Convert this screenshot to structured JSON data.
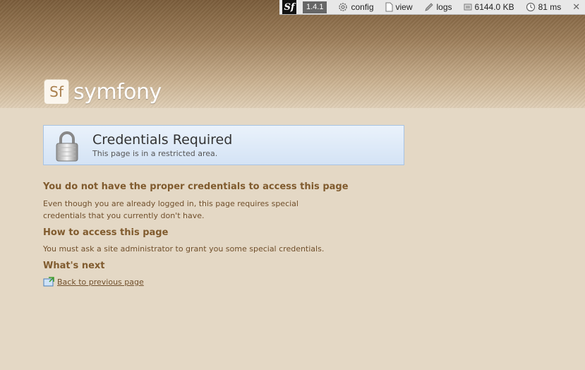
{
  "toolbar": {
    "logo": "Sf",
    "version": "1.4.1",
    "config": "config",
    "view": "view",
    "logs": "logs",
    "memory": "6144.0 KB",
    "time": "81 ms",
    "close": "✕"
  },
  "logo": {
    "mark": "Sf",
    "name": "symfony"
  },
  "notice": {
    "title": "Credentials Required",
    "subtitle": "This page is in a restricted area."
  },
  "sections": {
    "heading1": "You do not have the proper credentials to access this page",
    "text1": "Even though you are already logged in, this page requires special credentials that you currently don't have.",
    "heading2": "How to access this page",
    "text2": "You must ask a site administrator to grant you some special credentials.",
    "heading3": "What's next",
    "back_link": "Back to previous page"
  }
}
